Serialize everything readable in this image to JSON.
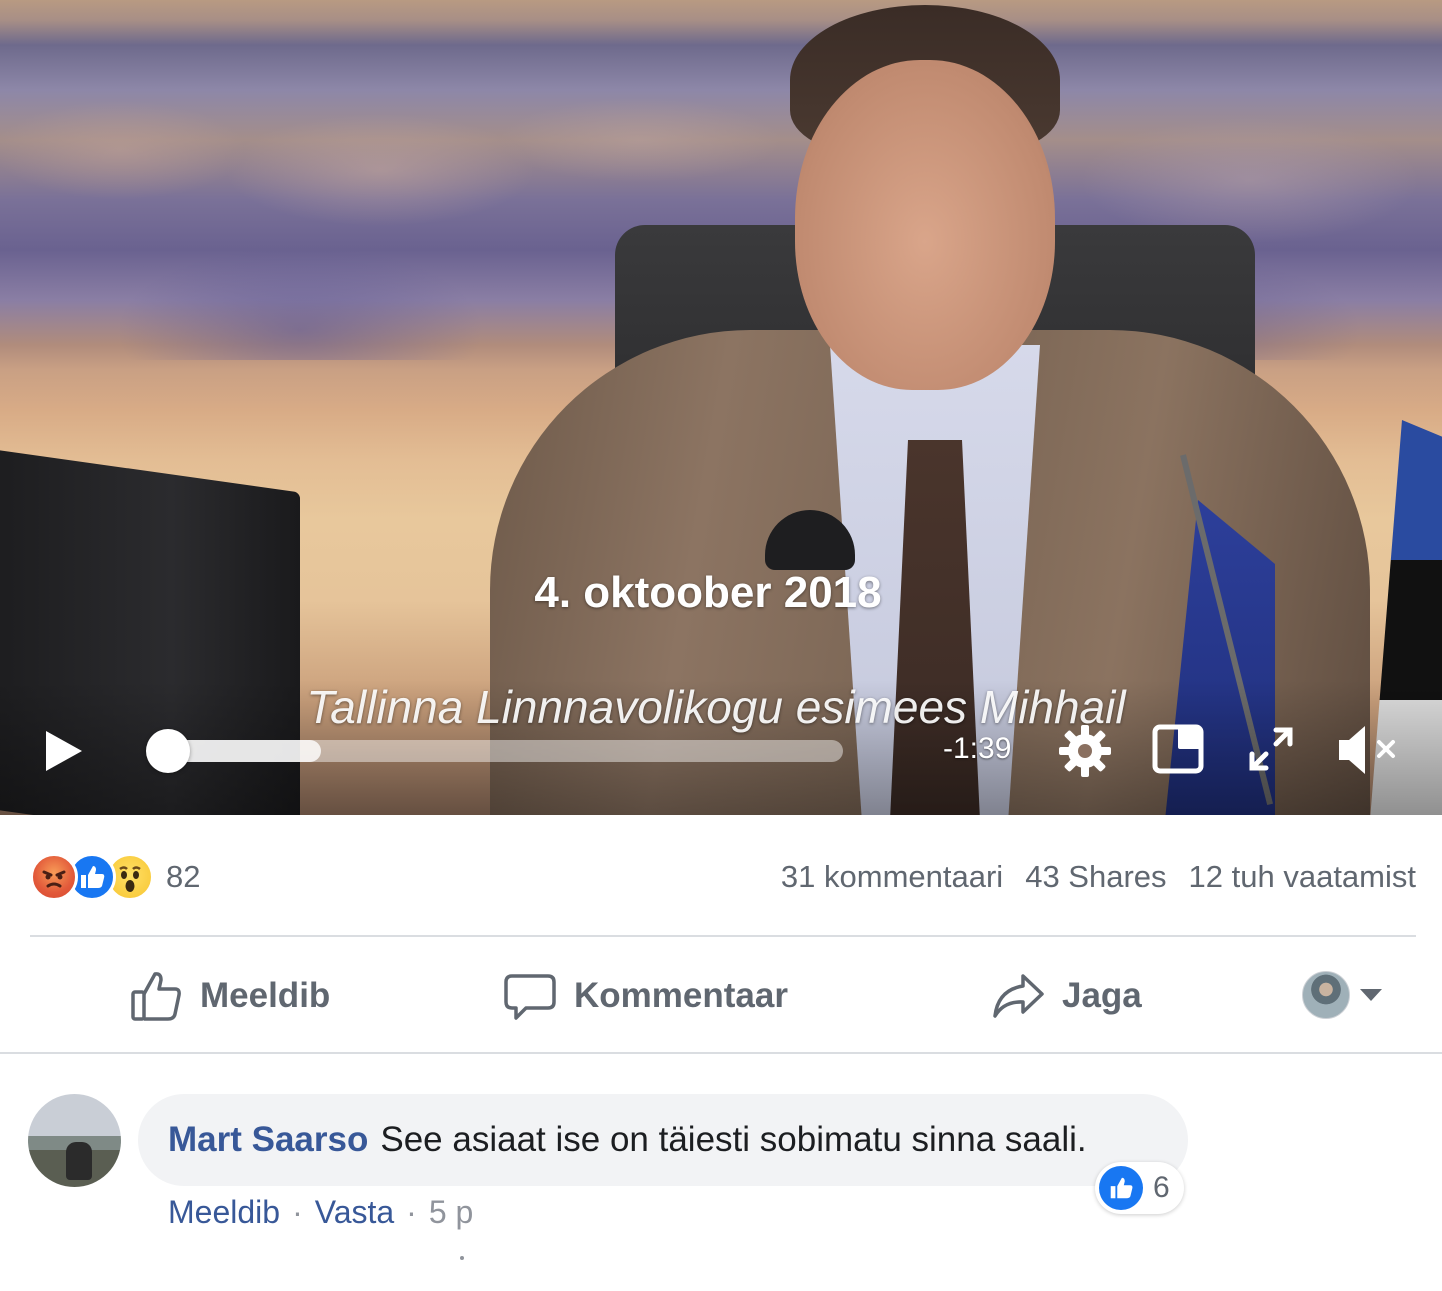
{
  "video": {
    "caption_date": "4. oktoober 2018",
    "caption_line": "Tallinna Linnnavolikogu esimees Mihhail",
    "time_remaining": "-1:39",
    "progress_fraction": 0.0,
    "buffered_fraction": 0.23,
    "controls": {
      "play_icon": "play-icon",
      "settings_icon": "gear-icon",
      "pip_icon": "picture-in-picture-icon",
      "fullscreen_icon": "fullscreen-icon",
      "mute_icon": "muted-speaker-icon"
    }
  },
  "stats": {
    "reactions": [
      "angry",
      "like",
      "wow"
    ],
    "reaction_count": "82",
    "comments": "31 kommentaari",
    "shares": "43 Shares",
    "views": "12 tuh vaatamist"
  },
  "actions": {
    "like": "Meeldib",
    "comment": "Kommentaar",
    "share": "Jaga"
  },
  "comment": {
    "author": "Mart Saarso",
    "text": "See asiaat ise on täiesti sobimatu sinna saali.",
    "like_count": "6",
    "meta": {
      "like": "Meeldib",
      "reply": "Vasta",
      "separator": "·",
      "time": "5 p"
    }
  },
  "colors": {
    "facebook_blue": "#1877f2",
    "link_blue": "#385898",
    "meta_gray": "#606770"
  }
}
